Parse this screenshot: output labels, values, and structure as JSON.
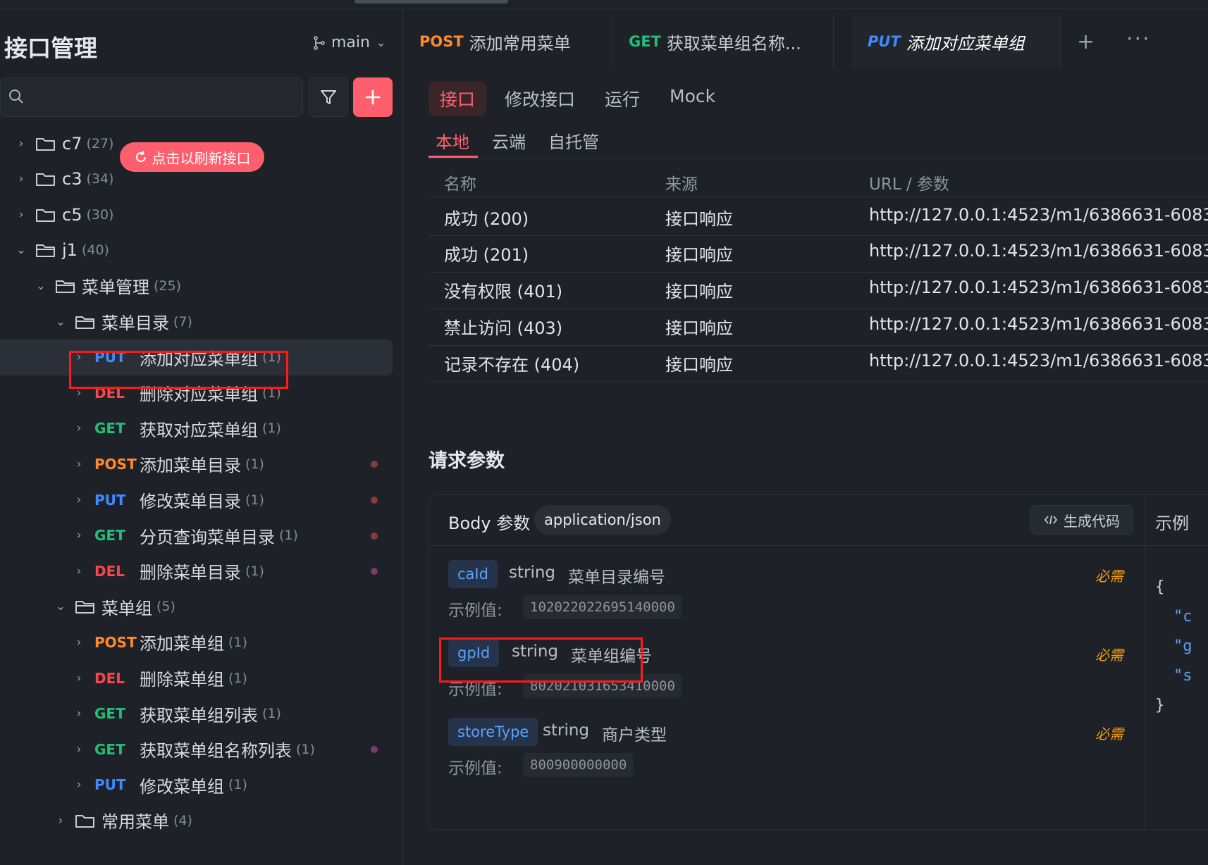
{
  "sidebar": {
    "title": "接口管理",
    "branch": "main",
    "search": {
      "placeholder": "",
      "value": ""
    },
    "refresh_label": "点击以刷新接口",
    "tree": [
      {
        "kind": "folder",
        "label": "c7",
        "count": "(27)",
        "expanded": false
      },
      {
        "kind": "folder",
        "label": "c3",
        "count": "(34)",
        "expanded": false
      },
      {
        "kind": "folder",
        "label": "c5",
        "count": "(30)",
        "expanded": false
      },
      {
        "kind": "folder",
        "label": "j1",
        "count": "(40)",
        "expanded": true
      },
      {
        "kind": "folder",
        "label": "菜单管理",
        "count": "(25)",
        "expanded": true
      },
      {
        "kind": "folder",
        "label": "菜单目录",
        "count": "(7)",
        "expanded": true
      },
      {
        "kind": "api",
        "method": "PUT",
        "label": "添加对应菜单组",
        "count": "(1)",
        "selected": true
      },
      {
        "kind": "api",
        "method": "DEL",
        "label": "删除对应菜单组",
        "count": "(1)"
      },
      {
        "kind": "api",
        "method": "GET",
        "label": "获取对应菜单组",
        "count": "(1)"
      },
      {
        "kind": "api",
        "method": "POST",
        "label": "添加菜单目录",
        "count": "(1)",
        "dot": "#8b3a3a"
      },
      {
        "kind": "api",
        "method": "PUT",
        "label": "修改菜单目录",
        "count": "(1)",
        "dot": "#8b3a3a"
      },
      {
        "kind": "api",
        "method": "GET",
        "label": "分页查询菜单目录",
        "count": "(1)",
        "dot": "#8b3a3a"
      },
      {
        "kind": "api",
        "method": "DEL",
        "label": "删除菜单目录",
        "count": "(1)",
        "dot": "#7a3a6a"
      },
      {
        "kind": "folder",
        "label": "菜单组",
        "count": "(5)",
        "expanded": true
      },
      {
        "kind": "api",
        "method": "POST",
        "label": "添加菜单组",
        "count": "(1)"
      },
      {
        "kind": "api",
        "method": "DEL",
        "label": "删除菜单组",
        "count": "(1)"
      },
      {
        "kind": "api",
        "method": "GET",
        "label": "获取菜单组列表",
        "count": "(1)"
      },
      {
        "kind": "api",
        "method": "GET",
        "label": "获取菜单组名称列表",
        "count": "(1)",
        "dot": "#7a3a6a"
      },
      {
        "kind": "api",
        "method": "PUT",
        "label": "修改菜单组",
        "count": "(1)"
      },
      {
        "kind": "folder",
        "label": "常用菜单",
        "count": "(4)",
        "expanded": false
      }
    ]
  },
  "tabs": [
    {
      "method": "POST",
      "title": "添加常用菜单"
    },
    {
      "method": "GET",
      "title": "获取菜单组名称..."
    },
    {
      "method": "PUT",
      "title": "添加对应菜单组",
      "active": true
    }
  ],
  "subtabs": [
    "接口",
    "修改接口",
    "运行",
    "Mock"
  ],
  "envtabs": [
    "本地",
    "云端",
    "自托管"
  ],
  "grid": {
    "headers": [
      "名称",
      "来源",
      "URL / 参数"
    ],
    "rows": [
      [
        "成功 (200)",
        "接口响应",
        "http://127.0.0.1:4523/m1/6386631-6083"
      ],
      [
        "成功 (201)",
        "接口响应",
        "http://127.0.0.1:4523/m1/6386631-6083"
      ],
      [
        "没有权限 (401)",
        "接口响应",
        "http://127.0.0.1:4523/m1/6386631-6083"
      ],
      [
        "禁止访问 (403)",
        "接口响应",
        "http://127.0.0.1:4523/m1/6386631-6083"
      ],
      [
        "记录不存在 (404)",
        "接口响应",
        "http://127.0.0.1:4523/m1/6386631-6083"
      ]
    ]
  },
  "request": {
    "section_title": "请求参数",
    "body_label": "Body 参数",
    "content_type": "application/json",
    "gen_code": "生成代码",
    "example_label": "示例",
    "params": [
      {
        "name": "caId",
        "type": "string",
        "desc": "菜单目录编号",
        "required": "必需",
        "ex_label": "示例值:",
        "example": "102022022695140000"
      },
      {
        "name": "gpId",
        "type": "string",
        "desc": "菜单组编号",
        "required": "必需",
        "ex_label": "示例值:",
        "example": "802021031653410000"
      },
      {
        "name": "storeType",
        "type": "string",
        "desc": "商户类型",
        "required": "必需",
        "ex_label": "示例值:",
        "example": "800900000000"
      }
    ],
    "json_preview": [
      "{",
      "\"c",
      "\"g",
      "\"s",
      "}"
    ]
  },
  "colors": {
    "accent": "#ff5f6d",
    "put": "#3d8bff",
    "del": "#f5484d",
    "get": "#1fbf75",
    "post": "#ff8a2b",
    "highlight": "#ff1a1a"
  }
}
